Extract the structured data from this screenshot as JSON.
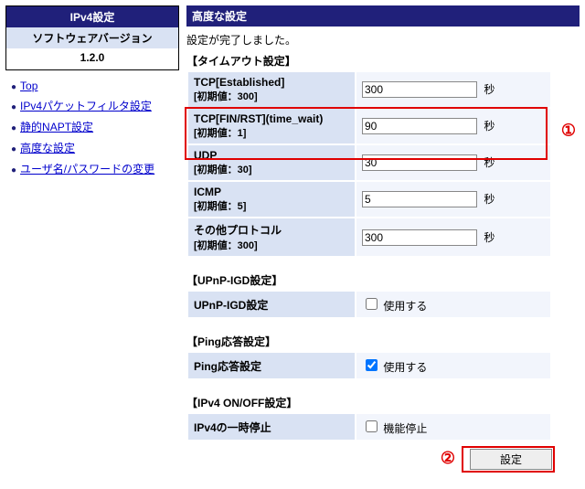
{
  "sidebar": {
    "title": "IPv4設定",
    "version_label": "ソフトウェアバージョン",
    "version": "1.2.0",
    "items": [
      {
        "label": "Top"
      },
      {
        "label": "IPv4パケットフィルタ設定"
      },
      {
        "label": "静的NAPT設定"
      },
      {
        "label": "高度な設定"
      },
      {
        "label": "ユーザ名/パスワードの変更"
      }
    ]
  },
  "main": {
    "title": "高度な設定",
    "status": "設定が完了しました。",
    "section_timeout": "【タイムアウト設定】",
    "timeout": {
      "tcp_est": {
        "label": "TCP[Established]",
        "init": "[初期値：300]",
        "value": "300",
        "unit": "秒"
      },
      "tcp_fin": {
        "label": "TCP[FIN/RST](time_wait)",
        "init": "[初期値：1]",
        "value": "90",
        "unit": "秒"
      },
      "udp": {
        "label": "UDP",
        "init": "[初期値：30]",
        "value": "30",
        "unit": "秒"
      },
      "icmp": {
        "label": "ICMP",
        "init": "[初期値：5]",
        "value": "5",
        "unit": "秒"
      },
      "other": {
        "label": "その他プロトコル",
        "init": "[初期値：300]",
        "value": "300",
        "unit": "秒"
      }
    },
    "section_upnp": "【UPnP-IGD設定】",
    "upnp": {
      "label": "UPnP-IGD設定",
      "checkbox_label": "使用する",
      "checked": false
    },
    "section_ping": "【Ping応答設定】",
    "ping": {
      "label": "Ping応答設定",
      "checkbox_label": "使用する",
      "checked": true
    },
    "section_ipv4": "【IPv4 ON/OFF設定】",
    "ipv4off": {
      "label": "IPv4の一時停止",
      "checkbox_label": "機能停止",
      "checked": false
    },
    "submit_label": "設定"
  },
  "annotations": {
    "circle1": "①",
    "circle2": "②"
  }
}
